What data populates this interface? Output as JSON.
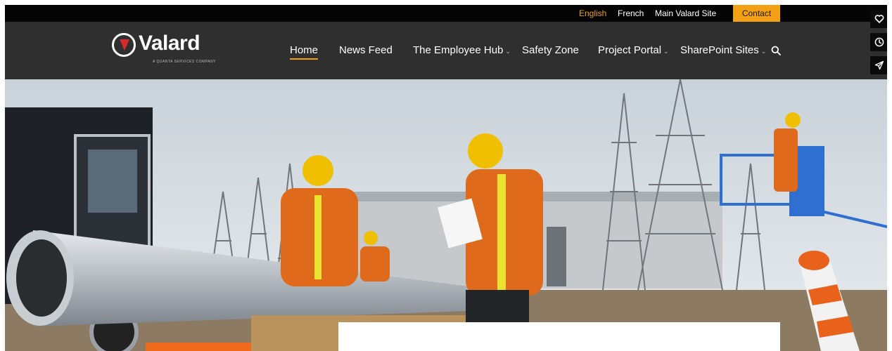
{
  "topbar": {
    "links": [
      {
        "label": "English",
        "active": true
      },
      {
        "label": "French",
        "active": false
      },
      {
        "label": "Main Valard Site",
        "active": false
      }
    ],
    "contact_label": "Contact"
  },
  "brand": {
    "name": "Valard",
    "tagline": "A QUANTA SERVICES COMPANY"
  },
  "nav": {
    "items": [
      {
        "label": "Home",
        "active": true,
        "dropdown": false
      },
      {
        "label": "News Feed",
        "active": false,
        "dropdown": false
      },
      {
        "label": "The Employee Hub",
        "active": false,
        "dropdown": true
      },
      {
        "label": "Safety Zone",
        "active": false,
        "dropdown": false
      },
      {
        "label": "Project Portal",
        "active": false,
        "dropdown": true
      },
      {
        "label": "SharePoint Sites",
        "active": false,
        "dropdown": true
      }
    ],
    "dropdown_glyph": "⌄"
  },
  "side_buttons": [
    "heart-icon",
    "clock-icon",
    "send-icon"
  ],
  "colors": {
    "accent": "#f4a014",
    "nav_bg": "#2f2f2f",
    "topbar_bg": "#050505",
    "brand_red": "#d62a2a"
  }
}
